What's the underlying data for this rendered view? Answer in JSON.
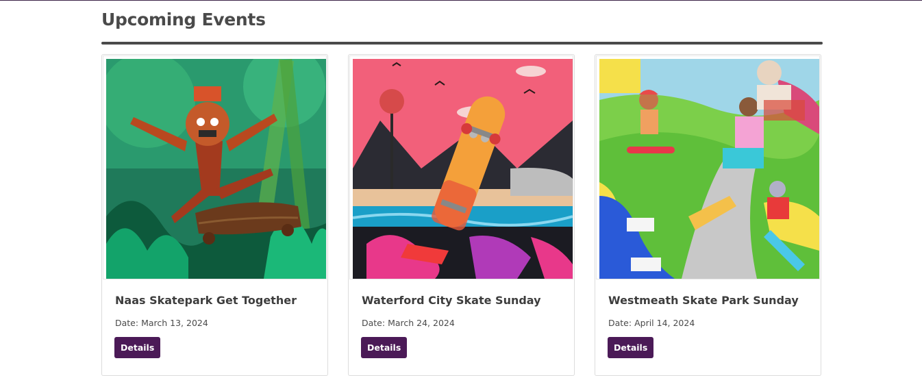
{
  "section": {
    "title": "Upcoming Events"
  },
  "colors": {
    "heading": "#4a4a4a",
    "button_bg": "#4b1a57",
    "button_text": "#ffffff",
    "card_border": "#dcdcdc"
  },
  "events": [
    {
      "title": "Naas Skatepark Get Together",
      "date_label": "Date:",
      "date": "March 13, 2024",
      "button_label": "Details",
      "image_description": "jungle-tiki-skater-illustration"
    },
    {
      "title": "Waterford City Skate Sunday",
      "date_label": "Date:",
      "date": "March 24, 2024",
      "button_label": "Details",
      "image_description": "pink-sky-skateboard-mountains-illustration"
    },
    {
      "title": "Westmeath Skate Park Sunday",
      "date_label": "Date:",
      "date": "April 14, 2024",
      "button_label": "Details",
      "image_description": "colorful-group-of-skaters-illustration"
    }
  ]
}
